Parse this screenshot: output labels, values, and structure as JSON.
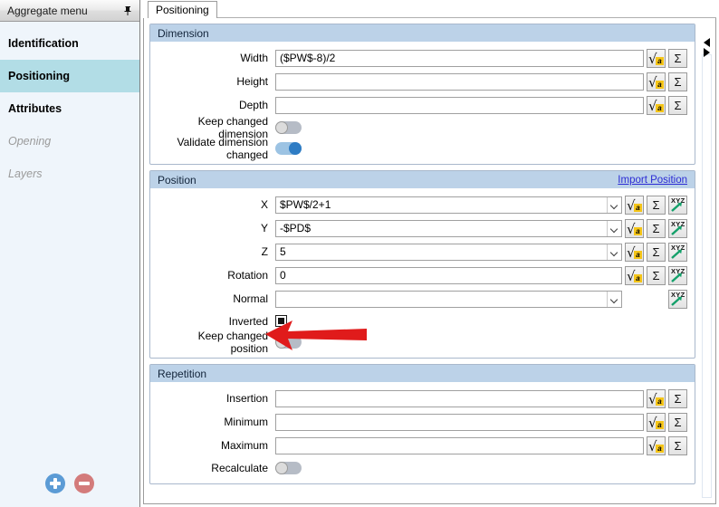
{
  "sidebar": {
    "header_title": "Aggregate menu",
    "pin_icon": "pin-icon",
    "items": [
      {
        "label": "Identification",
        "state": "normal"
      },
      {
        "label": "Positioning",
        "state": "selected"
      },
      {
        "label": "Attributes",
        "state": "normal"
      },
      {
        "label": "Opening",
        "state": "disabled"
      },
      {
        "label": "Layers",
        "state": "disabled"
      }
    ],
    "footer": {
      "add_label": "add-button",
      "remove_label": "remove-button",
      "add_color": "#5b9bd5",
      "remove_color": "#d37b7b"
    }
  },
  "tabs": [
    {
      "label": "Positioning",
      "active": true
    }
  ],
  "icons": {
    "formula": "√a",
    "sigma": "Σ",
    "xyz": "XYZ"
  },
  "colors": {
    "group_header": "#bcd2e8",
    "selection": "#b2dde6",
    "link": "#2b2bd4",
    "toggle_on": "#2e7cc4",
    "annotation_arrow": "#e01b1b"
  },
  "sections": {
    "dimension": {
      "title": "Dimension",
      "fields": [
        {
          "label": "Width",
          "value": "($PW$-8)/2"
        },
        {
          "label": "Height",
          "value": ""
        },
        {
          "label": "Depth",
          "value": ""
        }
      ],
      "toggles": [
        {
          "label": "Keep changed dimension",
          "state": "off"
        },
        {
          "label": "Validate dimension changed",
          "state": "on"
        }
      ]
    },
    "position": {
      "title": "Position",
      "import_link": "Import Position",
      "fields": [
        {
          "label": "X",
          "value": "$PW$/2+1",
          "dropdown": true,
          "xyz": true,
          "formula": true
        },
        {
          "label": "Y",
          "value": "-$PD$",
          "dropdown": true,
          "xyz": true,
          "formula": true
        },
        {
          "label": "Z",
          "value": "5",
          "dropdown": true,
          "xyz": true,
          "formula": true
        },
        {
          "label": "Rotation",
          "value": "0",
          "dropdown": false,
          "xyz": true,
          "formula": true
        },
        {
          "label": "Normal",
          "value": "",
          "dropdown": true,
          "xyz": true,
          "formula": false
        }
      ],
      "checkbox": {
        "label": "Inverted",
        "state": "filled"
      },
      "toggles": [
        {
          "label": "Keep changed position",
          "state": "off"
        }
      ]
    },
    "repetition": {
      "title": "Repetition",
      "fields": [
        {
          "label": "Insertion",
          "value": ""
        },
        {
          "label": "Minimum",
          "value": ""
        },
        {
          "label": "Maximum",
          "value": ""
        }
      ],
      "toggles": [
        {
          "label": "Recalculate",
          "state": "off"
        }
      ]
    }
  }
}
